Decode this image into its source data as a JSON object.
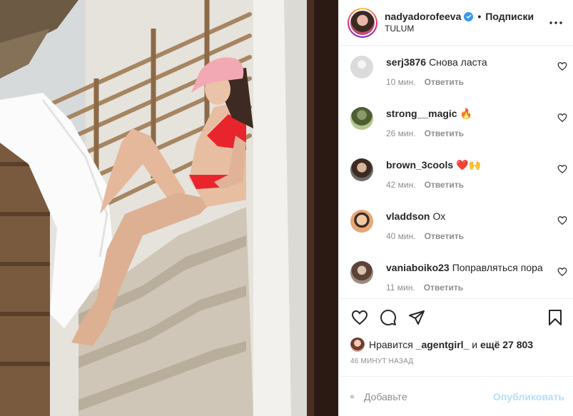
{
  "header": {
    "username": "nadyadorofeeva",
    "separator": "•",
    "follow_state": "Подписки",
    "location": "TULUM"
  },
  "comments": [
    {
      "user": "serj3876",
      "text": "Снова ласта",
      "time": "10 мин.",
      "reply": "Ответить",
      "avatar_color": "#dbdbdb"
    },
    {
      "user": "strong__magic",
      "text": "🔥",
      "time": "26 мин.",
      "reply": "Ответить",
      "avatar_color": "#556b3a"
    },
    {
      "user": "brown_3cools",
      "text": "❤️🙌",
      "time": "42 мин.",
      "reply": "Ответить",
      "avatar_color": "#4a3a32"
    },
    {
      "user": "vladdson",
      "text": "Ох",
      "time": "40 мин.",
      "reply": "Ответить",
      "avatar_color": "#d9a27a"
    },
    {
      "user": "vaniaboiko23",
      "text": "Поправляться пора",
      "time": "11 мин.",
      "reply": "Ответить",
      "avatar_color": "#6a5448"
    }
  ],
  "likes": {
    "prefix": "Нравится",
    "user": "_agentgirl_",
    "middle": "и",
    "count": "ещё 27 803"
  },
  "timestamp": "46 МИНУТ НАЗАД",
  "add_comment": {
    "placeholder": "Добавьте",
    "publish_label": "Опубликовать"
  },
  "colors": {
    "verified": "#3897f0",
    "publish_disabled": "#b2dffc",
    "swimsuit": "#e8242c",
    "cap": "#f3a9b4"
  },
  "icons": [
    "verified-icon",
    "more-icon",
    "heart-icon",
    "comment-icon",
    "share-icon",
    "save-icon",
    "emoji-icon"
  ]
}
